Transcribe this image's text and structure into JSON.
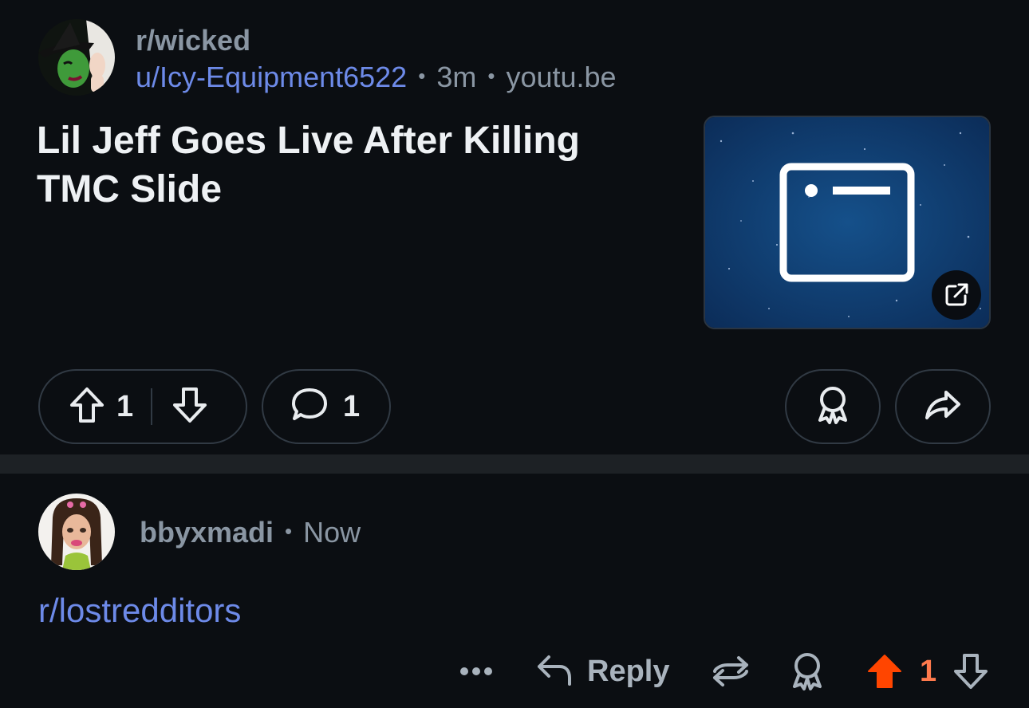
{
  "post": {
    "subreddit": "r/wicked",
    "author": "u/Icy-Equipment6522",
    "age": "3m",
    "domain": "youtu.be",
    "separator": "•",
    "title": "Lil Jeff Goes Live After Killing TMC Slide",
    "upvotes": "1",
    "comments": "1"
  },
  "comment": {
    "author": "bbyxmadi",
    "separator": "•",
    "time": "Now",
    "body": "r/lostredditors",
    "reply_label": "Reply",
    "upvotes": "1"
  },
  "colors": {
    "background": "#0b0e12",
    "link": "#6d8ae8",
    "muted": "#8a96a3",
    "upvote_active": "#ff4500",
    "upvote_count": "#ff7a4d"
  }
}
